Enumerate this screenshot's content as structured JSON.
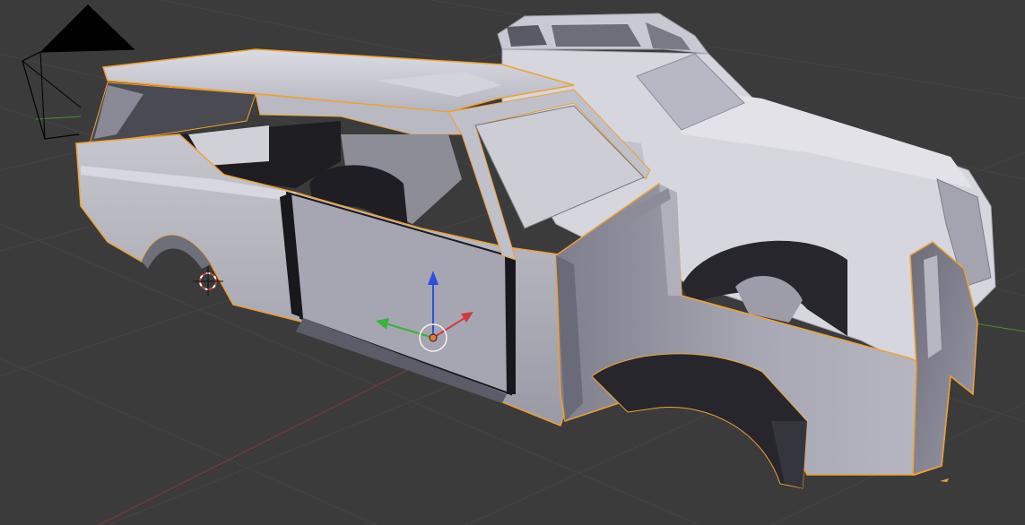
{
  "viewport": {
    "colors": {
      "background": "#3b3b3b",
      "grid": "#464646",
      "axis_x": "#8a3a3a",
      "axis_y": "#4f8a3a",
      "selection_outline": "#f0a030",
      "mesh_light": "#c9c9d1",
      "mesh_mid": "#a9a9b4",
      "mesh_dark": "#26262c",
      "gizmo_z": "#2a4fe0",
      "gizmo_x": "#d23a3a",
      "gizmo_y": "#3ab43a",
      "origin": "#e07c3a"
    },
    "icons": {
      "camera": "camera-icon",
      "cursor": "3d-cursor-icon",
      "gizmo": "transform-gizmo-icon",
      "origin": "object-origin-icon"
    }
  }
}
